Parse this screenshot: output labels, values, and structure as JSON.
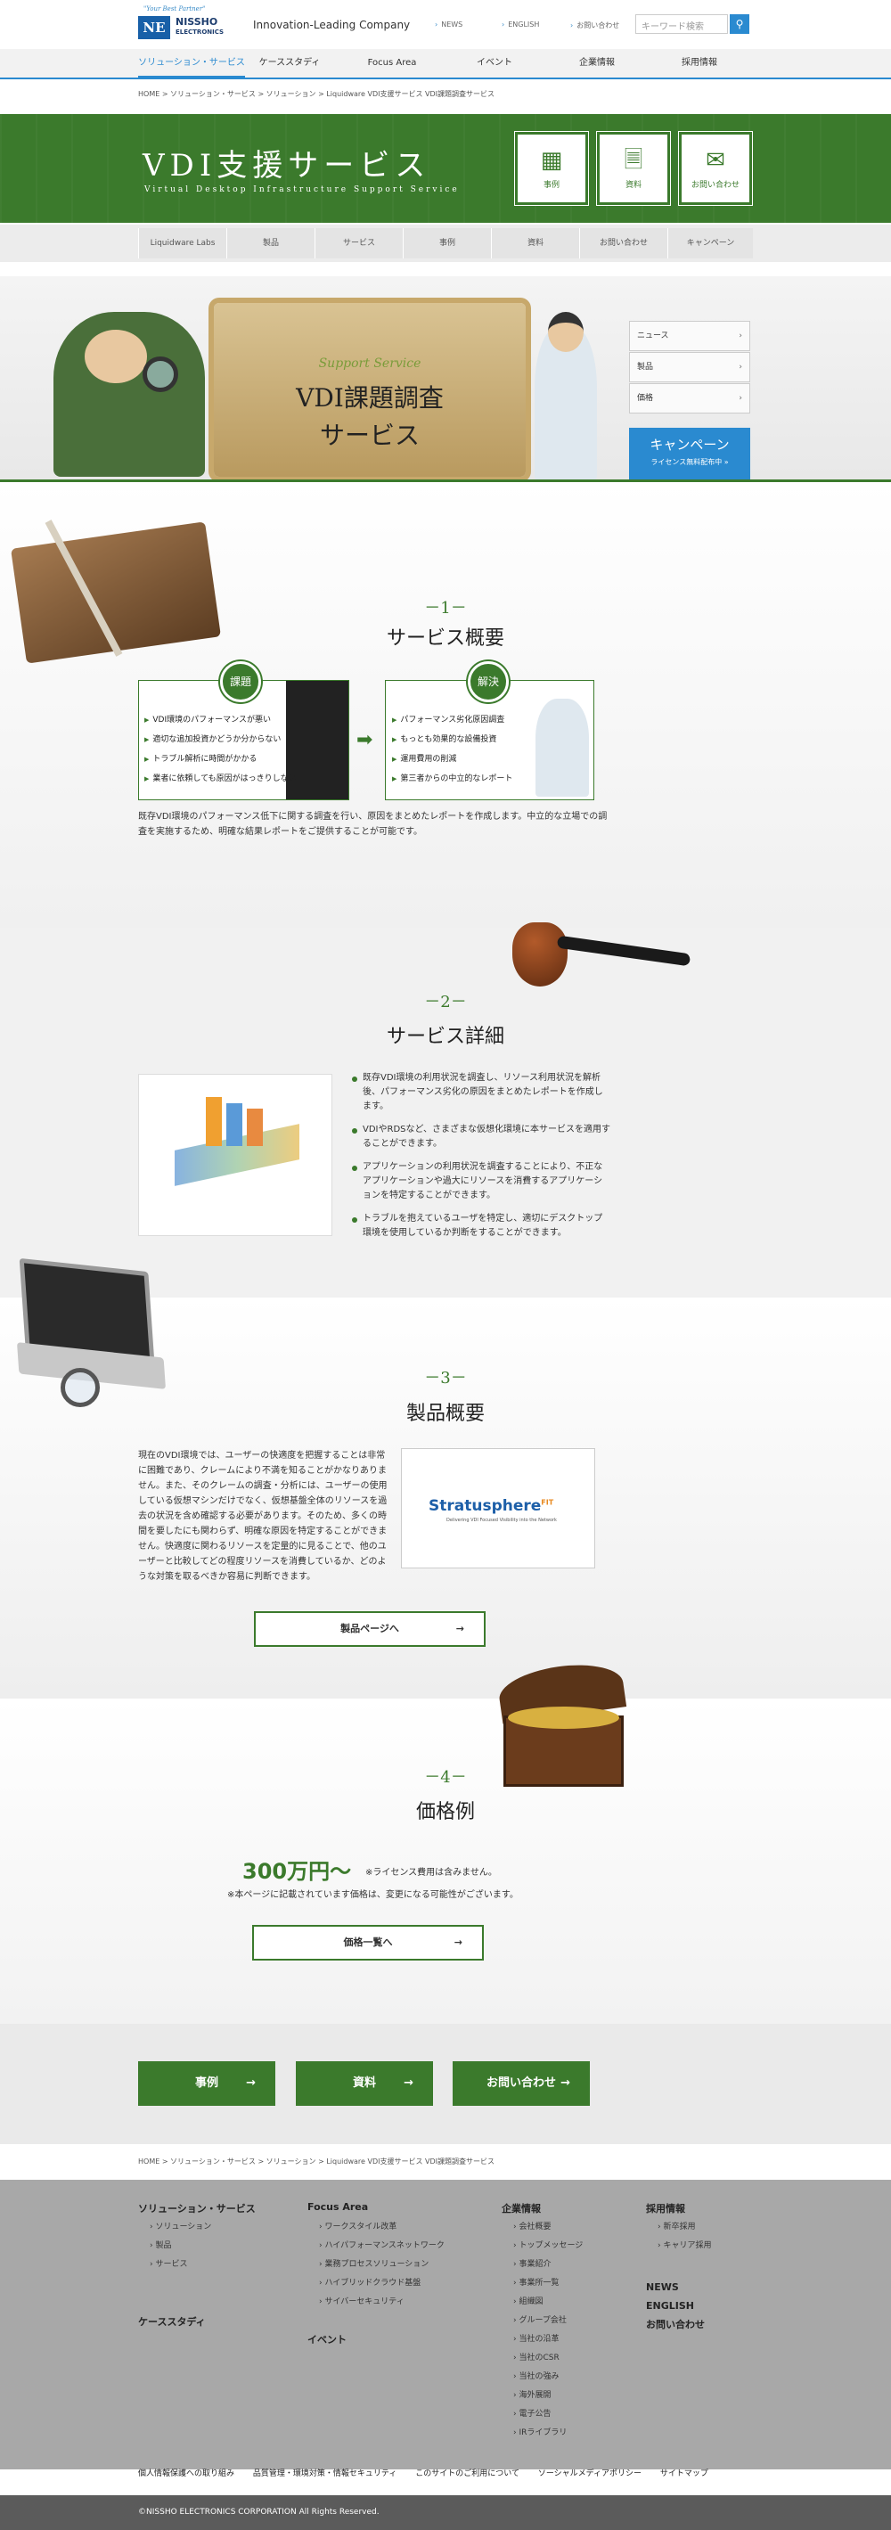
{
  "header": {
    "tagline": "\"Your Best Partner\"",
    "logo_mark": "NE",
    "logo_name": "NISSHO",
    "logo_sub": "ELECTRONICS",
    "slogan": "Innovation-Leading Company",
    "top_links": [
      "NEWS",
      "ENGLISH",
      "お問い合わせ"
    ],
    "search_placeholder": "キーワード検索"
  },
  "global_nav": [
    "ソリューション・サービス",
    "ケーススタディ",
    "Focus Area",
    "イベント",
    "企業情報",
    "採用情報"
  ],
  "breadcrumb": "HOME > ソリューション・サービス > ソリューション > Liquidware VDI支援サービス VDI課題調査サービス",
  "hero": {
    "title": "VDI支援サービス",
    "subtitle": "Virtual Desktop Infrastructure Support Service",
    "buttons": [
      {
        "label": "事例",
        "icon": "grid-doc-icon"
      },
      {
        "label": "資料",
        "icon": "documents-icon"
      },
      {
        "label": "お問い合わせ",
        "icon": "mail-icon"
      }
    ]
  },
  "sub_nav": [
    "Liquidware Labs",
    "製品",
    "サービス",
    "事例",
    "資料",
    "お問い合わせ",
    "キャンペーン"
  ],
  "banner": {
    "support": "Support Service",
    "line1": "VDI課題調査",
    "line2": "サービス",
    "side_links": [
      "ニュース",
      "製品",
      "価格"
    ],
    "campaign_title": "キャンペーン",
    "campaign_sub": "ライセンス無料配布中 »"
  },
  "section1": {
    "num": "－1－",
    "title": "サービス概要",
    "issue_label": "課題",
    "issues": [
      "VDI環境のパフォーマンスが悪い",
      "適切な追加投資かどうか分からない",
      "トラブル解析に時間がかかる",
      "業者に依頼しても原因がはっきりしない"
    ],
    "solution_label": "解決",
    "solutions": [
      "パフォーマンス劣化原因調査",
      "もっとも効果的な設備投資",
      "運用費用の削減",
      "第三者からの中立的なレポート"
    ],
    "description": "既存VDI環境のパフォーマンス低下に関する調査を行い、原因をまとめたレポートを作成します。中立的な立場での調査を実施するため、明確な結果レポートをご提供することが可能です。"
  },
  "section2": {
    "num": "－2－",
    "title": "サービス詳細",
    "points": [
      "既存VDI環境の利用状況を調査し、リソース利用状況を解析後、パフォーマンス劣化の原因をまとめたレポートを作成します。",
      "VDIやRDSなど、さまざまな仮想化環境に本サービスを適用することができます。",
      "アプリケーションの利用状況を調査することにより、不正なアプリケーションや過大にリソースを消費するアプリケーションを特定することができます。",
      "トラブルを抱えているユーザを特定し、適切にデスクトップ環境を使用しているか判断をすることができます。"
    ]
  },
  "section3": {
    "num": "－3－",
    "title": "製品概要",
    "description": "現在のVDI環境では、ユーザーの快適度を把握することは非常に困難であり、クレームにより不満を知ることがかなりありません。また、そのクレームの調査・分析には、ユーザーの使用している仮想マシンだけでなく、仮想基盤全体のリソースを過去の状況を含め確認する必要があります。そのため、多くの時間を要したにも関わらず、明確な原因を特定することができません。快適度に関わるリソースを定量的に見ることで、他のユーザーと比較してどの程度リソースを消費しているか、どのような対策を取るべきか容易に判断できます。",
    "product_logo": "Stratusphere",
    "product_logo_sup": "FIT",
    "product_tagline": "Delivering VDI Focused Visibility into the Network",
    "button": "製品ページへ"
  },
  "section4": {
    "num": "－4－",
    "title": "価格例",
    "price": "300万円〜",
    "note1": "※ライセンス費用は含みません。",
    "note2": "※本ページに記載されています価格は、変更になる可能性がございます。",
    "button": "価格一覧へ"
  },
  "bottom_buttons": [
    "事例",
    "資料",
    "お問い合わせ"
  ],
  "breadcrumb2": "HOME > ソリューション・サービス > ソリューション > Liquidware VDI支援サービス VDI課題調査サービス",
  "footer": {
    "col1_title": "ソリューション・サービス",
    "col1_links": [
      "ソリューション",
      "製品",
      "サービス"
    ],
    "col1_title2": "ケーススタディ",
    "col2_title": "Focus Area",
    "col2_links": [
      "ワークスタイル改革",
      "ハイパフォーマンスネットワーク",
      "業務プロセスソリューション",
      "ハイブリッドクラウド基盤",
      "サイバーセキュリティ"
    ],
    "col2_title2": "イベント",
    "col3_title": "企業情報",
    "col3_links": [
      "会社概要",
      "トップメッセージ",
      "事業紹介",
      "事業所一覧",
      "組織図",
      "グループ会社",
      "当社の沿革",
      "当社のCSR",
      "当社の強み",
      "海外展開",
      "電子公告",
      "IRライブラリ"
    ],
    "col4_title": "採用情報",
    "col4_links": [
      "新卒採用",
      "キャリア採用"
    ],
    "col4_extra": [
      "NEWS",
      "ENGLISH",
      "お問い合わせ"
    ],
    "bottom_links": [
      "個人情報保護への取り組み",
      "品質管理・環境対策・情報セキュリティ",
      "このサイトのご利用について",
      "ソーシャルメディアポリシー",
      "サイトマップ"
    ],
    "copyright": "©NISSHO ELECTRONICS CORPORATION All Rights Reserved."
  }
}
